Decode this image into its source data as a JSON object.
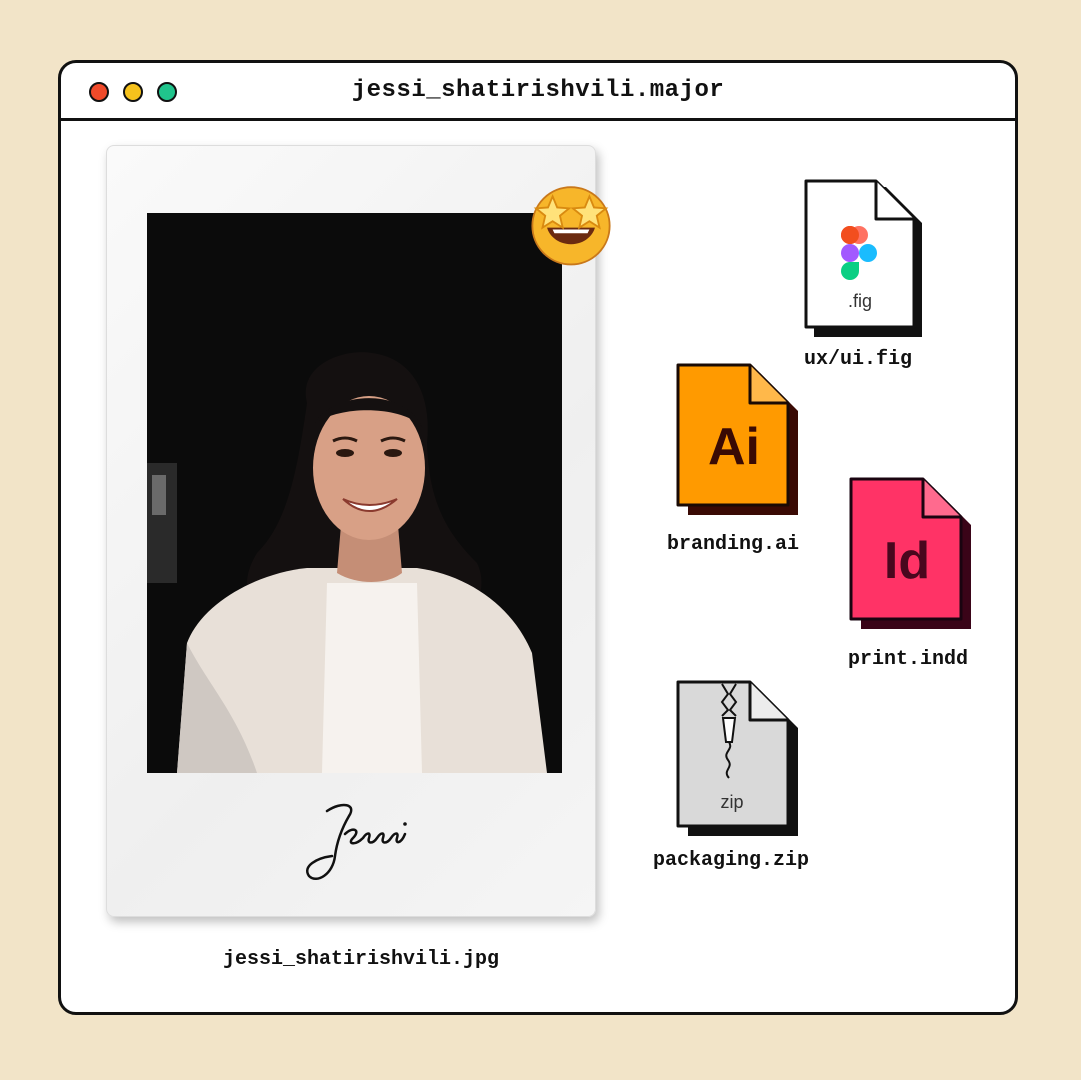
{
  "window": {
    "title": "jessi_shatirishvili.major"
  },
  "photo": {
    "filename": "jessi_shatirishvili.jpg",
    "signature": "Jessi"
  },
  "files": [
    {
      "name": "ux/ui.fig",
      "badge": ".fig",
      "color": "#ffffff",
      "icon": "figma-logo-icon"
    },
    {
      "name": "branding.ai",
      "badge": "Ai",
      "color": "#ff9a00",
      "icon": "illustrator-file-icon"
    },
    {
      "name": "print.indd",
      "badge": "Id",
      "color": "#ff3366",
      "icon": "indesign-file-icon"
    },
    {
      "name": "packaging.zip",
      "badge": "zip",
      "color": "#d9d9d9",
      "icon": "zip-file-icon"
    }
  ],
  "colors": {
    "background": "#f2e4c8",
    "close_dot": "#f04a2a",
    "minimize_dot": "#f6c21c",
    "maximize_dot": "#20c48c"
  }
}
